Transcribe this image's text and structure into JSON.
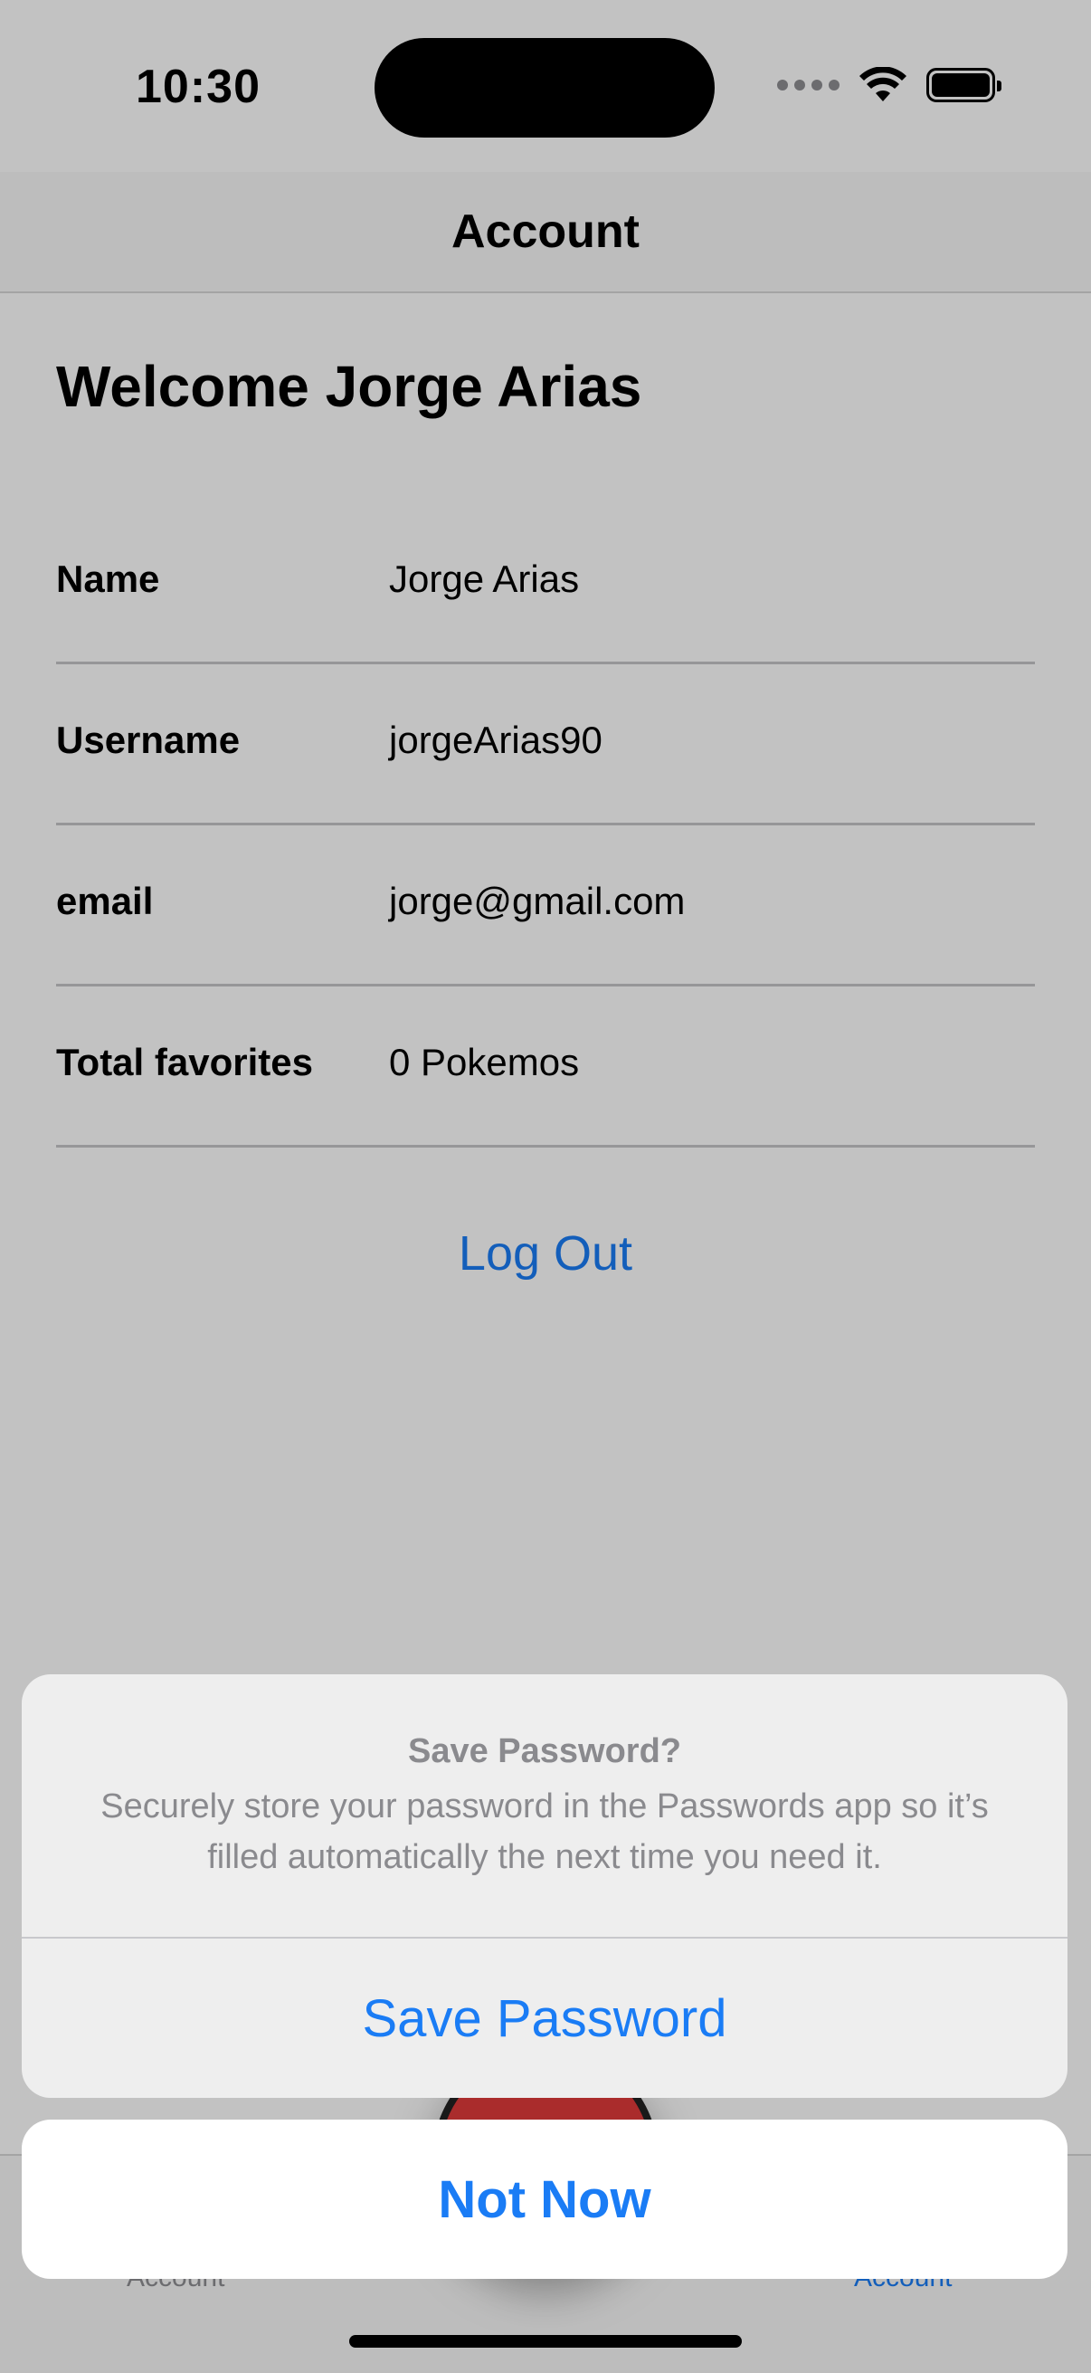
{
  "status_bar": {
    "time": "10:30",
    "icons": [
      "cellular-signal-icon",
      "wifi-icon",
      "battery-icon"
    ]
  },
  "nav": {
    "title": "Account"
  },
  "account": {
    "welcome": "Welcome Jorge Arias",
    "rows": [
      {
        "label": "Name",
        "value": "Jorge Arias"
      },
      {
        "label": "Username",
        "value": "jorgeArias90"
      },
      {
        "label": "email",
        "value": "jorge@gmail.com"
      },
      {
        "label": "Total favorites",
        "value": "0 Pokemos"
      }
    ],
    "logout_label": "Log Out"
  },
  "tab_bar": {
    "items": [
      {
        "label": "Account",
        "state": "inactive"
      },
      {
        "label": "Account",
        "state": "active"
      }
    ],
    "center_icon": "pokeball-icon"
  },
  "alert": {
    "title": "Save Password?",
    "message": "Securely store your password in the Passwords app so it’s filled automatically the next time you need it.",
    "save_label": "Save Password",
    "cancel_label": "Not Now"
  },
  "colors": {
    "accent": "#1a7cf5",
    "secondary_text": "#8a8a8e",
    "pokeball_red": "#e03a3a"
  }
}
